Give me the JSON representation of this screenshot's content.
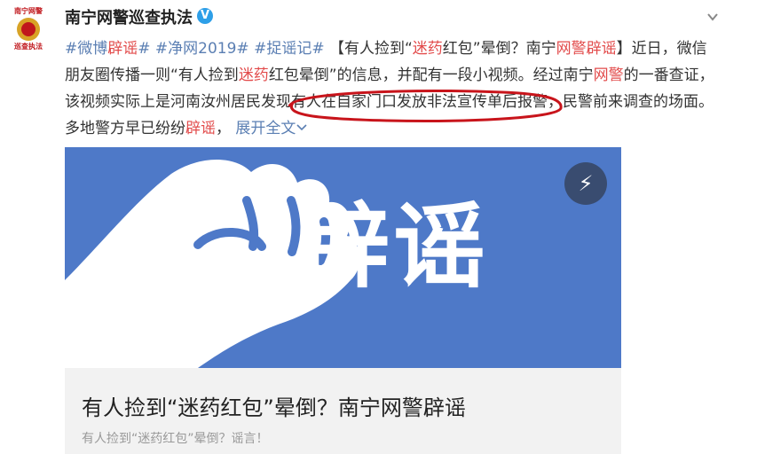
{
  "account": {
    "avatar_text": [
      "南宁网警",
      "巡查执法"
    ],
    "name": "南宁网警巡查执法",
    "verified": "V"
  },
  "post": {
    "tags": [
      "#微博",
      "辟谣",
      "#",
      "#净网2019#",
      "#捉谣记#"
    ],
    "bracket_open": "【有人捡到“",
    "red1": "迷药",
    "text1": "红包”晕倒？南宁",
    "red2": "网警",
    "red3": "辟谣",
    "text2": "】近日，微信朋友圈传播一则“有人捡到",
    "red4": "迷药",
    "text3": "红包晕倒”的信息，并配有一段小视频。经过南宁",
    "red5": "网警",
    "text4": "的一番查证，该视频实际上是河南汝州居民发现有人在自家门口发放非法宣传单后报警，民警前来调查的场面。多地警方早已纷纷",
    "red6": "辟谣",
    "text5": "，",
    "expand": "展开全文"
  },
  "card": {
    "banner": "辟谣",
    "title": "有人捡到“迷药红包”晕倒？南宁网警辟谣",
    "subtitle": "有人捡到“迷药红包”晕倒？谣言！"
  },
  "colors": {
    "link": "#5b7fb3",
    "highlight": "#e24b4b",
    "banner_bg": "#4e79c8",
    "annotation": "#c8141b"
  }
}
